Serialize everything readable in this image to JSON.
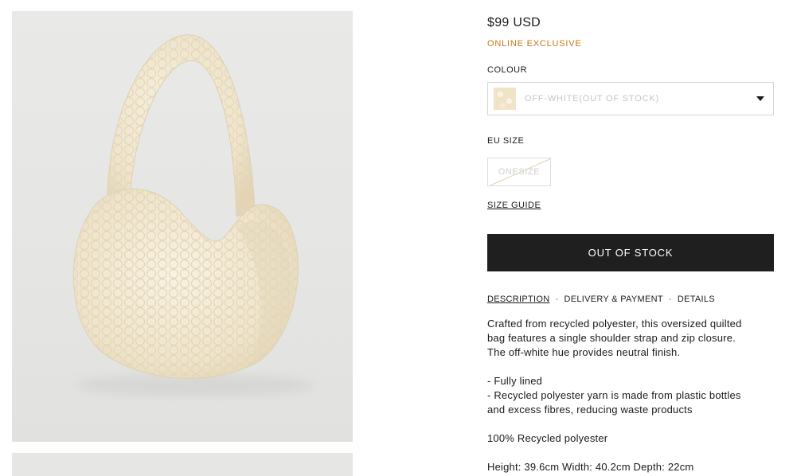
{
  "product": {
    "price": "$99 USD",
    "badge": "ONLINE EXCLUSIVE",
    "colour": {
      "label": "COLOUR",
      "selected": "OFF-WHITE(OUT OF STOCK)"
    },
    "size": {
      "label": "EU SIZE",
      "options": [
        "ONESIZE"
      ],
      "guide_label": "SIZE GUIDE"
    },
    "cta_label": "OUT OF STOCK"
  },
  "tabs": [
    {
      "label": "DESCRIPTION",
      "active": true
    },
    {
      "label": "DELIVERY & PAYMENT",
      "active": false
    },
    {
      "label": "DETAILS",
      "active": false
    }
  ],
  "tab_separator": "-",
  "description": {
    "intro_lines": [
      "Crafted from recycled polyester, this oversized quilted",
      "bag features a single shoulder strap and zip closure.",
      "The off-white hue provides neutral finish."
    ],
    "bullets": [
      "- Fully lined",
      "- Recycled polyester yarn is made from plastic bottles",
      "and excess fibres, reducing waste products"
    ],
    "composition": "100% Recycled polyester",
    "dimensions": "Height: 39.6cm Width: 40.2cm Depth: 22cm"
  },
  "colors": {
    "accent": "#c9761a",
    "button_bg": "#1f1f1f",
    "bag": "#f4ecd8",
    "image_bg": "#e6e6e4"
  }
}
